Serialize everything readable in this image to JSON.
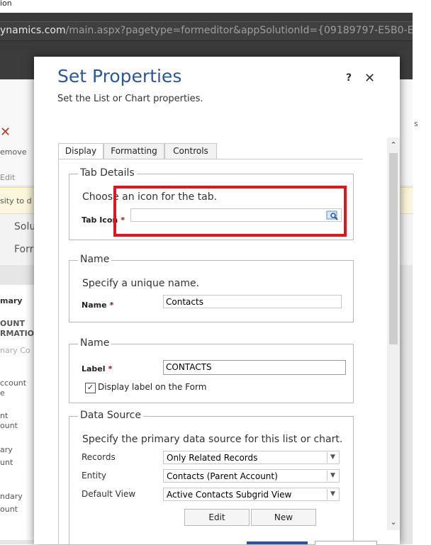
{
  "window": {
    "title_fragment": "ion"
  },
  "address_bar": {
    "host": "ynamics.com",
    "path": "/main.aspx?pagetype=formeditor&appSolutionId={09189797-E5B0-EA11-"
  },
  "background": {
    "ribbon_remove": "emove",
    "ribbon_edit": "Edit",
    "notice": "sity to d",
    "solu": "Solu",
    "form": "Forr",
    "primary": "mary",
    "account_info_1": "OUNT",
    "account_info_2": "RMATIO",
    "primary_contact": "nary Co",
    "account_name_1": "ccount",
    "account_name_2": "e",
    "parent_1": "nt",
    "parent_2": "ount",
    "primary_1": "ary",
    "primary_2": "unt",
    "secondary_1": "ndary",
    "secondary_2": "ount",
    "right_frag": "s"
  },
  "dialog": {
    "title": "Set Properties",
    "subtitle": "Set the List or Chart properties.",
    "help_label": "?",
    "close_label": "✕",
    "tabs": [
      {
        "label": "Display",
        "active": true
      },
      {
        "label": "Formatting",
        "active": false
      },
      {
        "label": "Controls",
        "active": false
      }
    ],
    "tab_details": {
      "legend": "Tab Details",
      "instruction": "Choose an icon for the tab.",
      "tab_icon_label": "Tab Icon",
      "required_mark": "*",
      "tab_icon_value": ""
    },
    "name_group": {
      "legend": "Name",
      "instruction": "Specify a unique name.",
      "name_label": "Name",
      "required_mark": "*",
      "name_value": "Contacts"
    },
    "label_group": {
      "legend": "Name",
      "label_label": "Label",
      "required_mark": "*",
      "label_value": "CONTACTS",
      "display_label_checkbox": "Display label on the Form",
      "display_label_checked": true
    },
    "data_source": {
      "legend": "Data Source",
      "instruction": "Specify the primary data source for this list or chart.",
      "records_label": "Records",
      "records_value": "Only Related Records",
      "entity_label": "Entity",
      "entity_value": "Contacts (Parent Account)",
      "default_view_label": "Default View",
      "default_view_value": "Active Contacts Subgrid View",
      "edit_button": "Edit",
      "new_button": "New"
    }
  },
  "colors": {
    "title_blue": "#2b579a",
    "highlight_red": "#e3141e",
    "required_red": "#cc0000"
  }
}
